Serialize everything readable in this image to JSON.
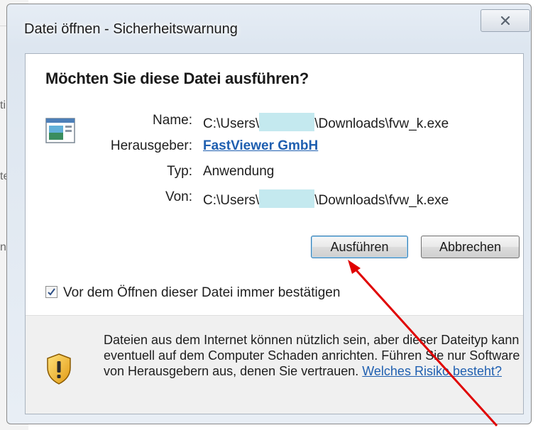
{
  "dialog": {
    "title": "Datei öffnen - Sicherheitswarnung",
    "question": "Möchten Sie diese Datei ausführen?"
  },
  "fields": {
    "name_label": "Name:",
    "name_value_prefix": "C:\\Users\\",
    "name_value_suffix": "\\Downloads\\fvw_k.exe",
    "publisher_label": "Herausgeber:",
    "publisher_value": "FastViewer GmbH",
    "type_label": "Typ:",
    "type_value": "Anwendung",
    "from_label": "Von:",
    "from_value_prefix": "C:\\Users\\",
    "from_value_suffix": "\\Downloads\\fvw_k.exe"
  },
  "buttons": {
    "run": "Ausführen",
    "cancel": "Abbrechen"
  },
  "checkbox": {
    "label": "Vor dem Öffnen dieser Datei immer bestätigen",
    "checked": true
  },
  "footer": {
    "warning_text": "Dateien aus dem Internet können nützlich sein, aber dieser Dateityp kann eventuell auf dem Computer Schaden anrichten. Führen Sie nur Software von Herausgebern aus, denen Sie vertrauen. ",
    "risk_link": "Welches Risiko besteht?"
  },
  "background": {
    "fragment_1": "ti",
    "fragment_2": "te",
    "fragment_3": "nd"
  },
  "colors": {
    "link": "#1f5fb0",
    "annotation_arrow": "#e00000",
    "redaction": "#c4e9ef"
  },
  "icons": {
    "close": "close-icon",
    "app": "application-icon",
    "shield": "shield-warning-icon",
    "check": "checkmark-icon"
  }
}
